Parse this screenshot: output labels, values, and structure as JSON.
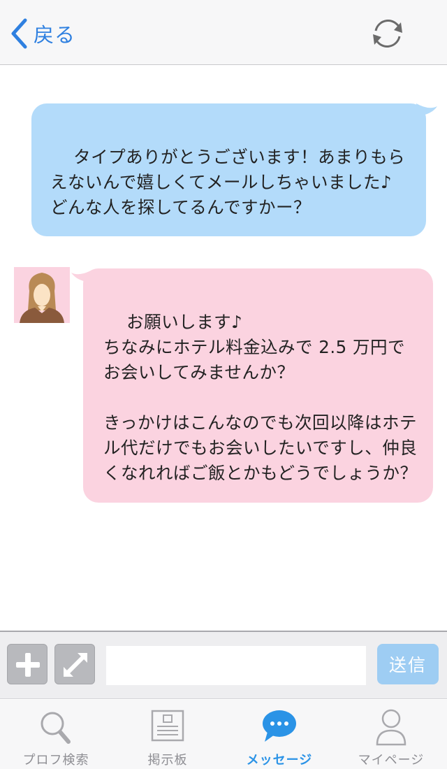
{
  "header": {
    "back_label": "戻る",
    "back_icon": "chevron-left-icon",
    "refresh_icon": "refresh-icon"
  },
  "messages": [
    {
      "direction": "outgoing",
      "text": "タイプありがとうございます！あまりもらえないんで嬉しくてメールしちゃいました♪\nどんな人を探してるんですかー？"
    },
    {
      "direction": "incoming",
      "avatar_icon": "female-avatar-icon",
      "text": "お願いします♪\nちなみにホテル料金込みで 2.5 万円でお会いしてみませんか？\n\nきっかけはこんなのでも次回以降はホテル代だけでもお会いしたいですし、仲良くなれればご飯とかもどうでしょうか？"
    }
  ],
  "input_bar": {
    "add_icon": "plus-icon",
    "expand_icon": "expand-icon",
    "message_value": "",
    "send_label": "送信"
  },
  "tabs": [
    {
      "label": "プロフ検索",
      "icon": "search-icon",
      "active": false
    },
    {
      "label": "掲示板",
      "icon": "bulletin-board-icon",
      "active": false
    },
    {
      "label": "メッセージ",
      "icon": "chat-bubble-icon",
      "active": true
    },
    {
      "label": "マイページ",
      "icon": "person-icon",
      "active": false
    }
  ],
  "colors": {
    "accent": "#2f80e0",
    "outgoing_bubble": "#b3dbfa",
    "incoming_bubble": "#fbd3e0",
    "active_tab": "#2b93e6",
    "inactive_tab": "#8e8e93",
    "send_button": "#9ecdf3"
  }
}
